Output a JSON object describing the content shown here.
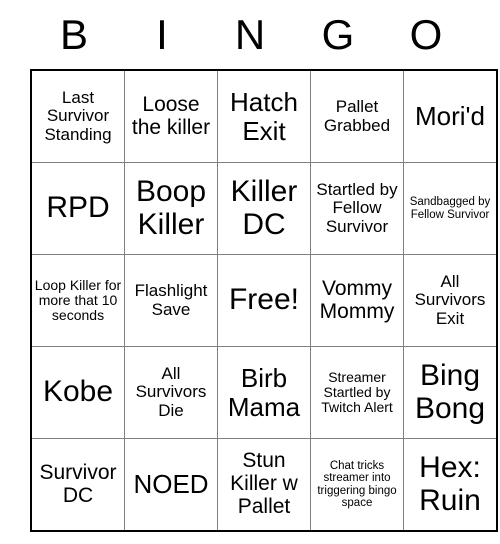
{
  "card": {
    "header_letters": [
      "B",
      "I",
      "N",
      "G",
      "O"
    ],
    "rows": [
      [
        {
          "text": "Last Survivor Standing",
          "size": "m"
        },
        {
          "text": "Loose the killer",
          "size": "l"
        },
        {
          "text": "Hatch Exit",
          "size": "xl"
        },
        {
          "text": "Pallet Grabbed",
          "size": "m"
        },
        {
          "text": "Mori'd",
          "size": "xl"
        }
      ],
      [
        {
          "text": "RPD",
          "size": "xxl"
        },
        {
          "text": "Boop Killer",
          "size": "xxl"
        },
        {
          "text": "Killer DC",
          "size": "xxl"
        },
        {
          "text": "Startled by Fellow Survivor",
          "size": "m"
        },
        {
          "text": "Sandbagged by Fellow Survivor",
          "size": "xs"
        }
      ],
      [
        {
          "text": "Loop Killer for more that 10 seconds",
          "size": "s"
        },
        {
          "text": "Flashlight Save",
          "size": "m"
        },
        {
          "text": "Free!",
          "size": "xxl"
        },
        {
          "text": "Vommy Mommy",
          "size": "l"
        },
        {
          "text": "All Survivors Exit",
          "size": "m"
        }
      ],
      [
        {
          "text": "Kobe",
          "size": "xxl"
        },
        {
          "text": "All Survivors Die",
          "size": "m"
        },
        {
          "text": "Birb Mama",
          "size": "xl"
        },
        {
          "text": "Streamer Startled by Twitch Alert",
          "size": "s"
        },
        {
          "text": "Bing Bong",
          "size": "xxl"
        }
      ],
      [
        {
          "text": "Survivor DC",
          "size": "l"
        },
        {
          "text": "NOED",
          "size": "xl"
        },
        {
          "text": "Stun Killer w Pallet",
          "size": "l"
        },
        {
          "text": "Chat tricks streamer into triggering bingo space",
          "size": "xs"
        },
        {
          "text": "Hex: Ruin",
          "size": "xxl"
        }
      ]
    ]
  }
}
